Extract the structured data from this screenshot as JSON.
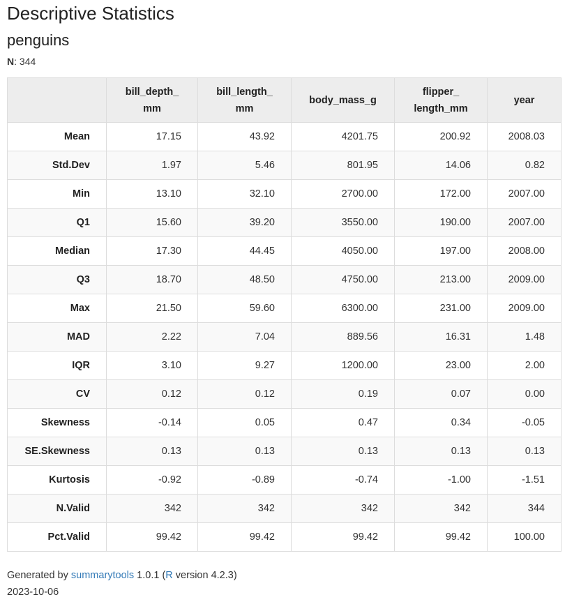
{
  "title": "Descriptive Statistics",
  "dataset": "penguins",
  "n_label": "N",
  "n_value": ": 344",
  "table": {
    "columns": [
      "",
      "bill_depth_\nmm",
      "bill_length_\nmm",
      "body_mass_g",
      "flipper_\nlength_mm",
      "year"
    ],
    "rows": [
      {
        "label": "Mean",
        "values": [
          "17.15",
          "43.92",
          "4201.75",
          "200.92",
          "2008.03"
        ]
      },
      {
        "label": "Std.Dev",
        "values": [
          "1.97",
          "5.46",
          "801.95",
          "14.06",
          "0.82"
        ]
      },
      {
        "label": "Min",
        "values": [
          "13.10",
          "32.10",
          "2700.00",
          "172.00",
          "2007.00"
        ]
      },
      {
        "label": "Q1",
        "values": [
          "15.60",
          "39.20",
          "3550.00",
          "190.00",
          "2007.00"
        ]
      },
      {
        "label": "Median",
        "values": [
          "17.30",
          "44.45",
          "4050.00",
          "197.00",
          "2008.00"
        ]
      },
      {
        "label": "Q3",
        "values": [
          "18.70",
          "48.50",
          "4750.00",
          "213.00",
          "2009.00"
        ]
      },
      {
        "label": "Max",
        "values": [
          "21.50",
          "59.60",
          "6300.00",
          "231.00",
          "2009.00"
        ]
      },
      {
        "label": "MAD",
        "values": [
          "2.22",
          "7.04",
          "889.56",
          "16.31",
          "1.48"
        ]
      },
      {
        "label": "IQR",
        "values": [
          "3.10",
          "9.27",
          "1200.00",
          "23.00",
          "2.00"
        ]
      },
      {
        "label": "CV",
        "values": [
          "0.12",
          "0.12",
          "0.19",
          "0.07",
          "0.00"
        ]
      },
      {
        "label": "Skewness",
        "values": [
          "-0.14",
          "0.05",
          "0.47",
          "0.34",
          "-0.05"
        ]
      },
      {
        "label": "SE.Skewness",
        "values": [
          "0.13",
          "0.13",
          "0.13",
          "0.13",
          "0.13"
        ]
      },
      {
        "label": "Kurtosis",
        "values": [
          "-0.92",
          "-0.89",
          "-0.74",
          "-1.00",
          "-1.51"
        ]
      },
      {
        "label": "N.Valid",
        "values": [
          "342",
          "342",
          "342",
          "342",
          "344"
        ]
      },
      {
        "label": "Pct.Valid",
        "values": [
          "99.42",
          "99.42",
          "99.42",
          "99.42",
          "100.00"
        ]
      }
    ]
  },
  "footer": {
    "generated_by": "Generated by ",
    "tool_link": "summarytools",
    "tool_version": " 1.0.1 (",
    "r_link": "R",
    "r_version": " version 4.2.3)",
    "date": "2023-10-06"
  },
  "colors": {
    "link": "#337ab7",
    "header_bg": "#ededed",
    "border": "#dddddd",
    "stripe": "#f9f9f9"
  }
}
